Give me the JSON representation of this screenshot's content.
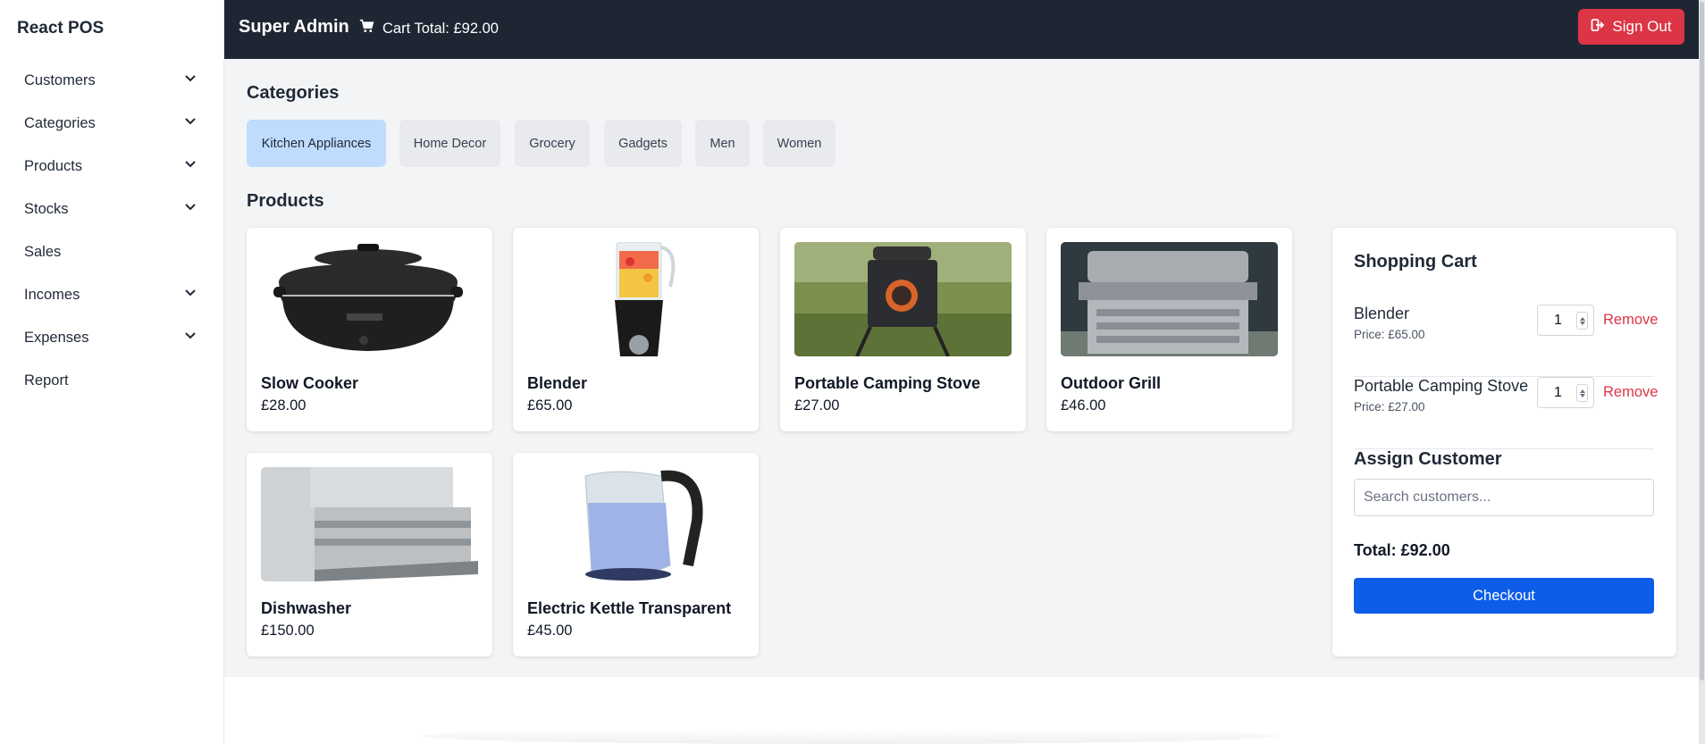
{
  "sidebar": {
    "brand": "React POS",
    "items": [
      {
        "label": "Customers",
        "dropdown": true
      },
      {
        "label": "Categories",
        "dropdown": true
      },
      {
        "label": "Products",
        "dropdown": true
      },
      {
        "label": "Stocks",
        "dropdown": true
      },
      {
        "label": "Sales",
        "dropdown": false
      },
      {
        "label": "Incomes",
        "dropdown": true
      },
      {
        "label": "Expenses",
        "dropdown": true
      },
      {
        "label": "Report",
        "dropdown": false
      }
    ]
  },
  "topbar": {
    "user": "Super Admin",
    "cart_total": "Cart Total: £92.00",
    "sign_out": "Sign Out"
  },
  "categories": {
    "title": "Categories",
    "items": [
      "Kitchen Appliances",
      "Home Decor",
      "Grocery",
      "Gadgets",
      "Men",
      "Women"
    ],
    "active": "Kitchen Appliances"
  },
  "products": {
    "title": "Products",
    "items": [
      {
        "name": "Slow Cooker",
        "price": "£28.00"
      },
      {
        "name": "Blender",
        "price": "£65.00"
      },
      {
        "name": "Portable Camping Stove",
        "price": "£27.00"
      },
      {
        "name": "Outdoor Grill",
        "price": "£46.00"
      },
      {
        "name": "Dishwasher",
        "price": "£150.00"
      },
      {
        "name": "Electric Kettle Transparent",
        "price": "£45.00"
      }
    ]
  },
  "cart": {
    "title": "Shopping Cart",
    "items": [
      {
        "name": "Blender",
        "price": "Price: £65.00",
        "qty": "1",
        "remove": "Remove"
      },
      {
        "name": "Portable Camping Stove",
        "price": "Price: £27.00",
        "qty": "1",
        "remove": "Remove"
      }
    ],
    "assign_title": "Assign Customer",
    "search_placeholder": "Search customers...",
    "total": "Total: £92.00",
    "checkout": "Checkout"
  },
  "colors": {
    "topbar": "#1f2633",
    "danger": "#dc3545",
    "primary": "#0d5de8",
    "active_category": "#bfdbfe"
  }
}
